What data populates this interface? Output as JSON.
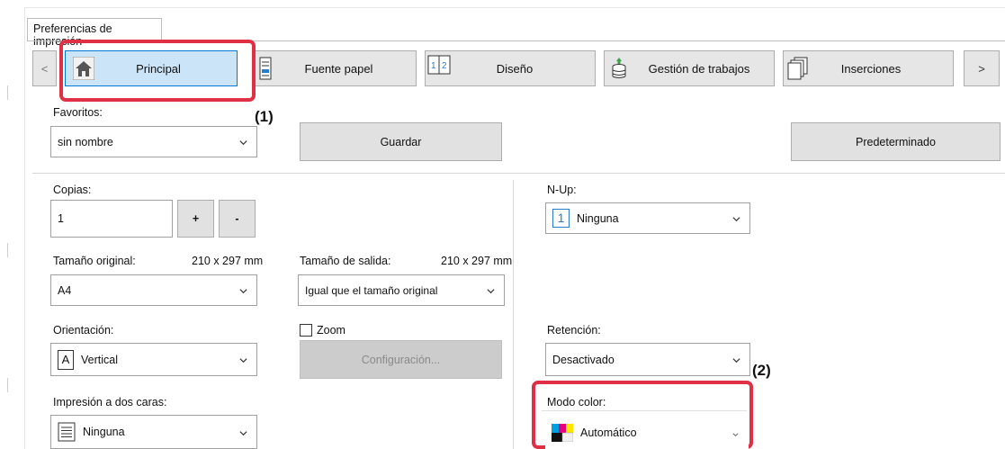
{
  "window": {
    "title": "Preferencias de impresión"
  },
  "tabs": {
    "prev_label": "<",
    "next_label": ">",
    "items": [
      {
        "label": "Principal",
        "icon": "home-icon",
        "selected": true
      },
      {
        "label": "Fuente papel",
        "icon": "paper-tray-icon"
      },
      {
        "label": "Diseño",
        "icon": "layout-icon"
      },
      {
        "label": "Gestión de trabajos",
        "icon": "job-stack-icon"
      },
      {
        "label": "Inserciones",
        "icon": "insert-pages-icon"
      }
    ]
  },
  "callouts": {
    "one": "(1)",
    "two": "(2)"
  },
  "favorites": {
    "label": "Favoritos:",
    "value": "sin nombre",
    "save_label": "Guardar",
    "default_label": "Predeterminado"
  },
  "copies": {
    "label": "Copias:",
    "value": "1",
    "plus_label": "+",
    "minus_label": "-"
  },
  "original_size": {
    "label": "Tamaño original:",
    "dimensions": "210 x 297 mm",
    "value": "A4"
  },
  "output_size": {
    "label": "Tamaño de salida:",
    "dimensions": "210 x 297 mm",
    "value": "Igual que el tamaño original"
  },
  "orientation": {
    "label": "Orientación:",
    "value": "Vertical",
    "icon_glyph": "A"
  },
  "zoom": {
    "label": "Zoom",
    "checked": false,
    "config_label": "Configuración..."
  },
  "duplex": {
    "label": "Impresión a dos caras:",
    "value": "Ninguna"
  },
  "nup": {
    "label": "N-Up:",
    "value": "Ninguna",
    "icon_glyph": "1"
  },
  "retention": {
    "label": "Retención:",
    "value": "Desactivado"
  },
  "color_mode": {
    "label": "Modo color:",
    "value": "Automático"
  },
  "colors": {
    "selected_tab_bg": "#cce4f7",
    "selected_tab_border": "#0078d7",
    "highlight": "#e03046"
  }
}
